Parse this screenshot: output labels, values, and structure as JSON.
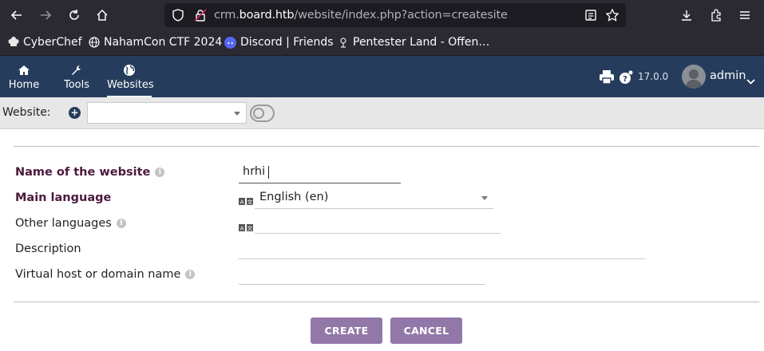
{
  "browser": {
    "url_prefix": "crm.",
    "url_host": "board.htb",
    "url_path": "/website/index.php?action=createsite",
    "bookmarks": [
      {
        "label": "CyberChef",
        "icon": "chef-hat-icon"
      },
      {
        "label": "NahamCon CTF 2024",
        "icon": "globe-icon"
      },
      {
        "label": "Discord | Friends",
        "icon": "discord-icon"
      },
      {
        "label": "Pentester Land - Offen…",
        "icon": "pentester-land-icon"
      }
    ]
  },
  "header": {
    "menu": [
      {
        "label": "Home",
        "icon": "home-icon"
      },
      {
        "label": "Tools",
        "icon": "wrench-icon"
      },
      {
        "label": "Websites",
        "icon": "globe-icon",
        "active": true
      }
    ],
    "version": "17.0.0",
    "user": "admin"
  },
  "sitebar": {
    "label": "Website:",
    "selected": ""
  },
  "form": {
    "name_label": "Name of the website",
    "name_value": "hrhi",
    "main_lang_label": "Main language",
    "main_lang_value": "English (en)",
    "other_lang_label": "Other languages",
    "other_lang_value": "",
    "description_label": "Description",
    "description_value": "",
    "vhost_label": "Virtual host or domain name",
    "vhost_value": ""
  },
  "buttons": {
    "create": "CREATE",
    "cancel": "CANCEL"
  },
  "colors": {
    "header_bg": "#263c5c",
    "required_label": "#4a1a3c",
    "button": "#9278a8"
  }
}
